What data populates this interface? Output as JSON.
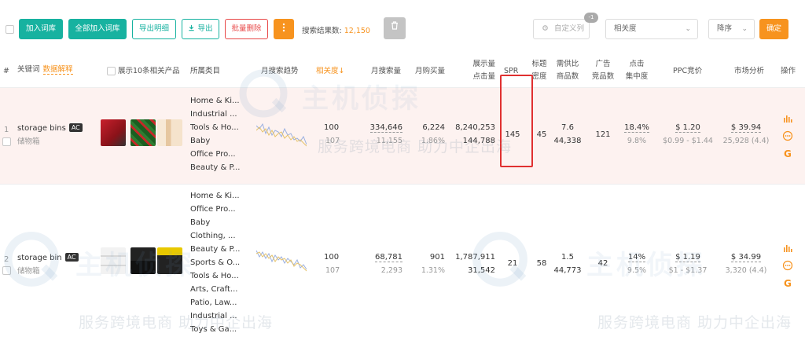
{
  "toolbar": {
    "add_to_library": "加入词库",
    "add_all_to_library": "全部加入词库",
    "export_detail": "导出明细",
    "export": "导出",
    "batch_delete": "批量删除",
    "more_icon": "more-vertical-icon",
    "search_result_label": "搜索结果数:",
    "search_result_count": "12,150",
    "trash_icon": "trash-icon",
    "custom_columns": "自定义列",
    "custom_columns_badge": "-1",
    "sort_field": "相关度",
    "sort_order": "降序",
    "confirm": "确定"
  },
  "header": {
    "index": "#",
    "keyword": "关键词",
    "data_explain": "数据解释",
    "show_top10": "展示10条相关产品",
    "category": "所属类目",
    "monthly_search_trend": "月搜索趋势",
    "relevance": "相关度",
    "monthly_search_volume": "月搜索量",
    "monthly_purchase": "月购买量",
    "impressions_clicks_1": "展示量",
    "impressions_clicks_2": "点击量",
    "spr": "SPR",
    "title_density_1": "标题",
    "title_density_2": "密度",
    "supply_demand_1": "需供比",
    "supply_demand_2": "商品数",
    "ad_products_1": "广告",
    "ad_products_2": "竞品数",
    "click_concentration_1": "点击",
    "click_concentration_2": "集中度",
    "ppc_bid": "PPC竞价",
    "market_analysis": "市场分析",
    "actions": "操作"
  },
  "rows": [
    {
      "index": "1",
      "keyword": "storage bins",
      "badge": "AC",
      "translation": "储物箱",
      "categories": [
        "Home & Ki...",
        "Industrial ...",
        "Tools & Ho...",
        "Baby",
        "Office Pro...",
        "Beauty & P..."
      ],
      "relevance": "100",
      "relevance_sub": "107",
      "search_volume": "334,646",
      "search_volume_sub": "11,155",
      "purchases": "6,224",
      "purchase_rate": "1.86%",
      "impressions": "8,240,253",
      "clicks": "144,788",
      "spr": "145",
      "title_density": "45",
      "supply_demand": "7.6",
      "products": "44,338",
      "ad_products": "121",
      "click_concentration": "18.4%",
      "click_concentration_sub": "9.8%",
      "ppc": "$ 1.20",
      "ppc_range": "$0.99 - $1.44",
      "market": "$ 39.94",
      "market_sub": "25,928 (4.4)"
    },
    {
      "index": "2",
      "keyword": "storage bin",
      "badge": "AC",
      "translation": "储物箱",
      "categories": [
        "Home & Ki...",
        "Office Pro...",
        "Baby",
        "Clothing, ...",
        "Beauty & P...",
        "Sports & O...",
        "Tools & Ho...",
        "Arts, Craft...",
        "Patio, Law...",
        "Industrial ...",
        "Toys & Ga..."
      ],
      "relevance": "100",
      "relevance_sub": "107",
      "search_volume": "68,781",
      "search_volume_sub": "2,293",
      "purchases": "901",
      "purchase_rate": "1.31%",
      "impressions": "1,787,911",
      "clicks": "31,542",
      "spr": "21",
      "title_density": "58",
      "supply_demand": "1.5",
      "products": "44,773",
      "ad_products": "42",
      "click_concentration": "14%",
      "click_concentration_sub": "9.5%",
      "ppc": "$ 1.19",
      "ppc_range": "$1 - $1.37",
      "market": "$ 34.99",
      "market_sub": "3,320 (4.4)"
    }
  ],
  "watermark": {
    "logo_text": "主机侦探",
    "slogan": "服务跨境电商 助力中企出海"
  },
  "colors": {
    "accent_green": "#17b2a0",
    "accent_orange": "#f7931e",
    "danger_red": "#e84747",
    "highlight_row": "#fdf2f0",
    "spr_highlight_border": "#e03030"
  }
}
